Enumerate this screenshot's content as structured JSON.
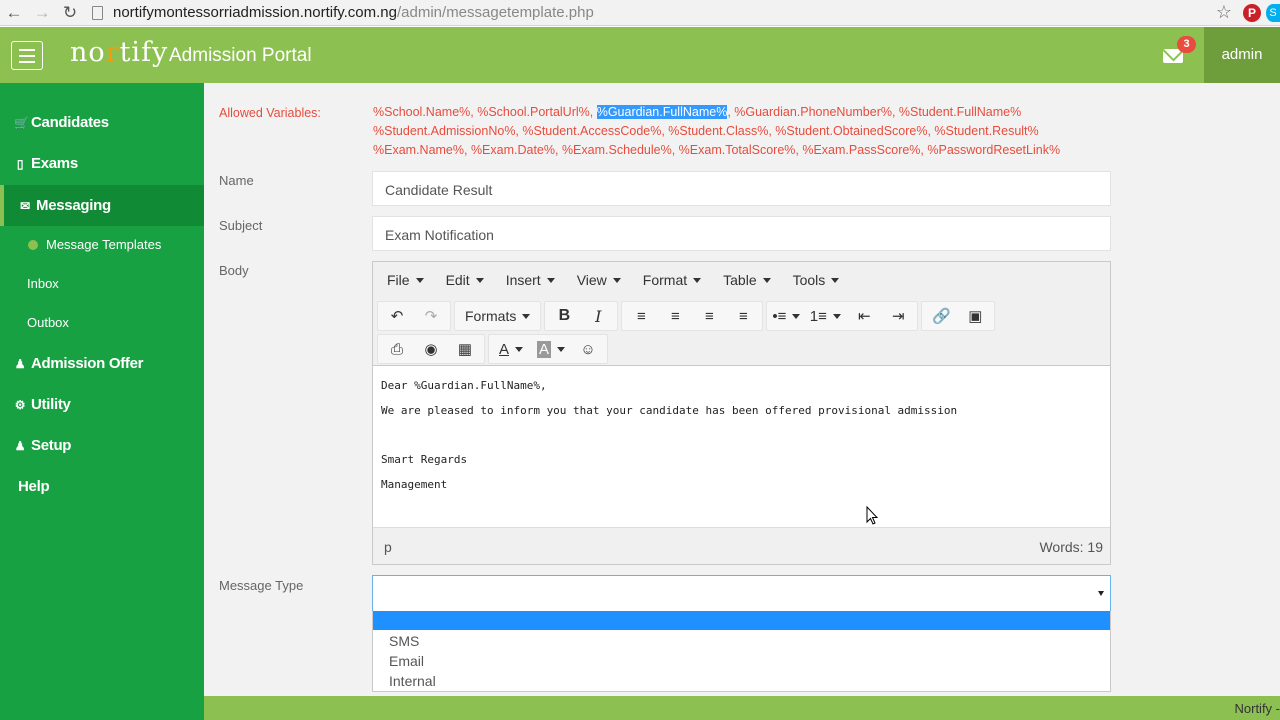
{
  "browser": {
    "url_host": "nortifymontessorriadmission.nortify.com.ng",
    "url_path": "/admin/messagetemplate.php",
    "icons": [
      "back-icon",
      "forward-icon",
      "reload-icon",
      "page-icon",
      "star-icon",
      "pinterest-icon",
      "skype-icon"
    ]
  },
  "header": {
    "logo": "nortify",
    "title": "Admission Portal",
    "mail_badge": "3",
    "user": "admin"
  },
  "sidebar": {
    "items": [
      {
        "label": "Candidates",
        "icon": "cart-icon"
      },
      {
        "label": "Exams",
        "icon": "book-icon"
      },
      {
        "label": "Messaging",
        "icon": "envelope-icon"
      },
      {
        "label": "Message Templates",
        "icon": "circle-icon"
      },
      {
        "label": "Inbox"
      },
      {
        "label": "Outbox"
      },
      {
        "label": "Admission Offer",
        "icon": "user-icon"
      },
      {
        "label": "Utility",
        "icon": "gear-icon"
      },
      {
        "label": "Setup",
        "icon": "user-icon"
      },
      {
        "label": "Help"
      }
    ]
  },
  "form": {
    "allowed_label": "Allowed Variables:",
    "vars_line1_a": "%School.Name%, %School.PortalUrl%, ",
    "vars_line1_hl": "%Guardian.FullName%",
    "vars_line1_b": ", %Guardian.PhoneNumber%, %Student.FullName%",
    "vars_line2": "%Student.AdmissionNo%, %Student.AccessCode%, %Student.Class%, %Student.ObtainedScore%, %Student.Result%",
    "vars_line3": "%Exam.Name%, %Exam.Date%, %Exam.Schedule%, %Exam.TotalScore%, %Exam.PassScore%, %PasswordResetLink%",
    "name_label": "Name",
    "name_value": "Candidate Result",
    "subject_label": "Subject",
    "subject_value": "Exam Notification",
    "body_label": "Body",
    "message_type_label": "Message Type"
  },
  "editor": {
    "menu": [
      "File",
      "Edit",
      "Insert",
      "View",
      "Format",
      "Table",
      "Tools"
    ],
    "formats_label": "Formats",
    "content": {
      "line1": "Dear %Guardian.FullName%,",
      "line2": "We are pleased to inform you that your candidate has been offered provisional admission",
      "line3": "Smart Regards",
      "line4": "Management"
    },
    "status_path": "p",
    "word_count": "Words: 19"
  },
  "message_type": {
    "selected": "",
    "options": [
      "",
      "SMS",
      "Email",
      "Internal"
    ]
  },
  "footer": {
    "text": "Nortify - "
  }
}
